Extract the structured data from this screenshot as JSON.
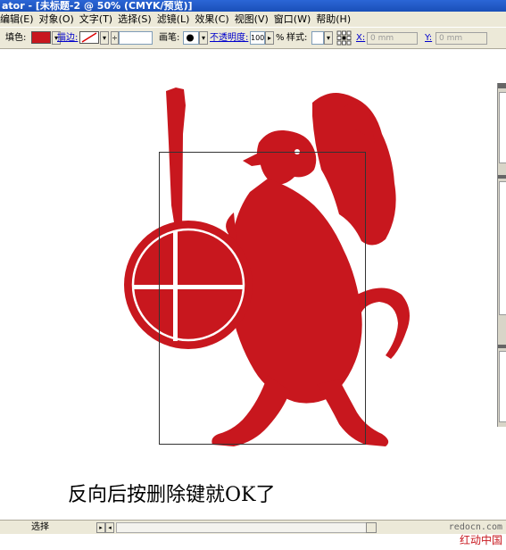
{
  "app": {
    "title": "ator - [未标题-2 @ 50% (CMYK/预览)]"
  },
  "menu": [
    "编辑(E)",
    "对象(O)",
    "文字(T)",
    "选择(S)",
    "滤镜(L)",
    "效果(C)",
    "视图(V)",
    "窗口(W)",
    "帮助(H)"
  ],
  "controlbar": {
    "fill_label": "填色:",
    "stroke_label": "描边:",
    "brush_label": "画笔:",
    "opacity_label": "不透明度:",
    "opacity_value": "100",
    "opacity_unit": "%",
    "style_label": "样式:",
    "x_label": "X:",
    "x_value": "0 mm",
    "y_label": "Y:",
    "y_value": "0 mm",
    "fill_color": "#c8171e"
  },
  "canvas": {
    "artwork_color": "#c8171e",
    "caption": "反向后按删除键就OK了"
  },
  "statusbar": {
    "mode": "选择"
  },
  "watermark": {
    "url": "redocn.com",
    "name": "红动中国"
  }
}
